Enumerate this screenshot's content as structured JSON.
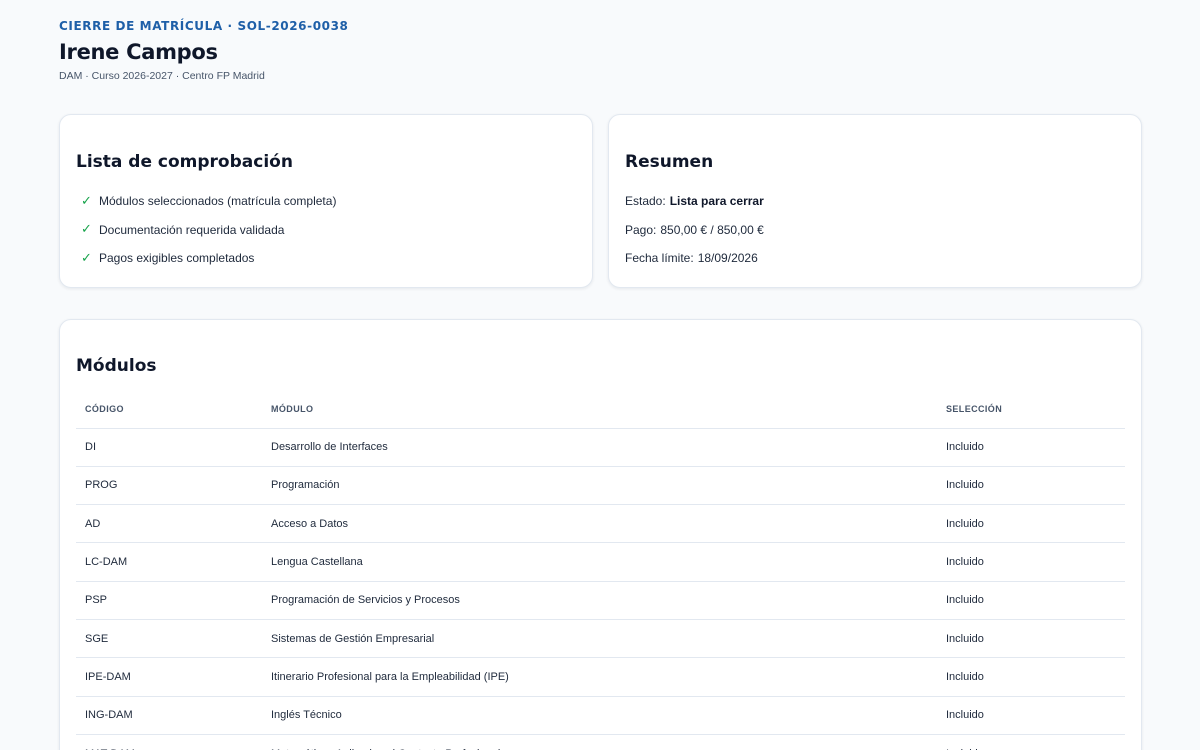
{
  "header": {
    "eyebrow": "CIERRE DE MATRÍCULA · SOL-2026-0038",
    "student_name": "Irene Campos",
    "subline": "DAM · Curso 2026-2027 · Centro FP Madrid"
  },
  "checklist": {
    "title": "Lista de comprobación",
    "items": [
      {
        "label": "Módulos seleccionados (matrícula completa)",
        "done": true,
        "icon": "checkmark-icon"
      },
      {
        "label": "Documentación requerida validada",
        "done": true,
        "icon": "checkmark-icon"
      },
      {
        "label": "Pagos exigibles completados",
        "done": true,
        "icon": "checkmark-icon"
      }
    ]
  },
  "summary": {
    "title": "Resumen",
    "estado_label": "Estado:",
    "estado_value": "Lista para cerrar",
    "pago_label": "Pago:",
    "pago_value": "850,00 € / 850,00 €",
    "fecha_label": "Fecha límite:",
    "fecha_value": "18/09/2026"
  },
  "modules": {
    "title": "Módulos",
    "columns": [
      "CÓDIGO",
      "MÓDULO",
      "SELECCIÓN"
    ],
    "rows": [
      {
        "code": "DI",
        "name": "Desarrollo de Interfaces",
        "selection": "Incluido"
      },
      {
        "code": "PROG",
        "name": "Programación",
        "selection": "Incluido"
      },
      {
        "code": "AD",
        "name": "Acceso a Datos",
        "selection": "Incluido"
      },
      {
        "code": "LC-DAM",
        "name": "Lengua Castellana",
        "selection": "Incluido"
      },
      {
        "code": "PSP",
        "name": "Programación de Servicios y Procesos",
        "selection": "Incluido"
      },
      {
        "code": "SGE",
        "name": "Sistemas de Gestión Empresarial",
        "selection": "Incluido"
      },
      {
        "code": "IPE-DAM",
        "name": "Itinerario Profesional para la Empleabilidad (IPE)",
        "selection": "Incluido"
      },
      {
        "code": "ING-DAM",
        "name": "Inglés Técnico",
        "selection": "Incluido"
      },
      {
        "code": "MAT-DAM",
        "name": "Matemáticas Aplicadas al Contexto Profesional",
        "selection": "Incluido"
      }
    ]
  },
  "colors": {
    "accent": "#1e5fa8",
    "check": "#16a34a",
    "background": "#f8fafc"
  }
}
